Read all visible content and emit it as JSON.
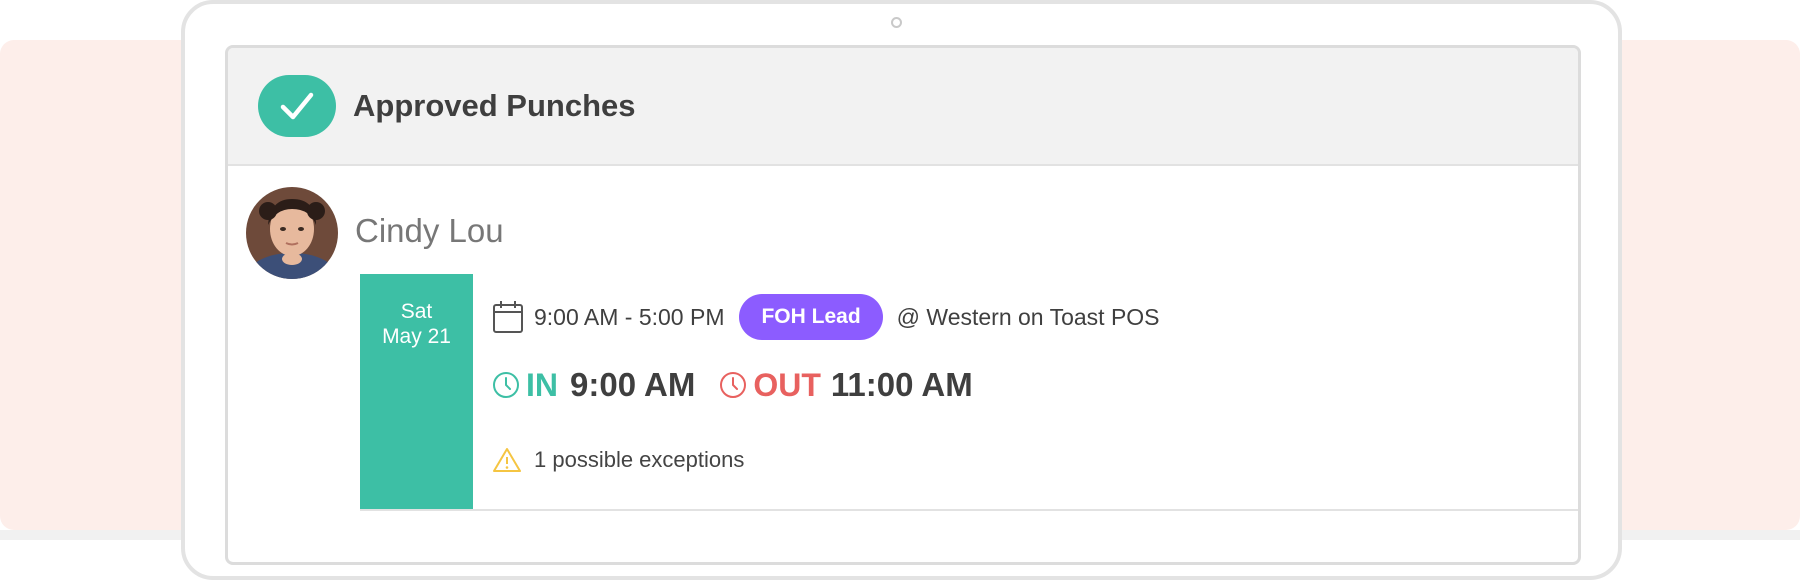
{
  "header": {
    "title": "Approved Punches"
  },
  "employee": {
    "name": "Cindy Lou"
  },
  "shift": {
    "day": "Sat",
    "date": "May 21",
    "time_range": "9:00 AM - 5:00 PM",
    "role": "FOH Lead",
    "location": "@ Western on Toast POS"
  },
  "punches": {
    "in_label": "IN",
    "in_time": "9:00 AM",
    "out_label": "OUT",
    "out_time": "11:00 AM"
  },
  "exceptions": {
    "text": "1 possible exceptions"
  },
  "colors": {
    "accent_teal": "#3dbfa5",
    "role_purple": "#8c5cff",
    "out_red": "#e8615f",
    "warning_yellow": "#f5c542",
    "background_blush": "#fdeeea"
  },
  "icons": {
    "header": "check-icon",
    "shift": "calendar-icon",
    "in": "clock-icon",
    "out": "clock-icon",
    "exception": "warning-icon"
  }
}
